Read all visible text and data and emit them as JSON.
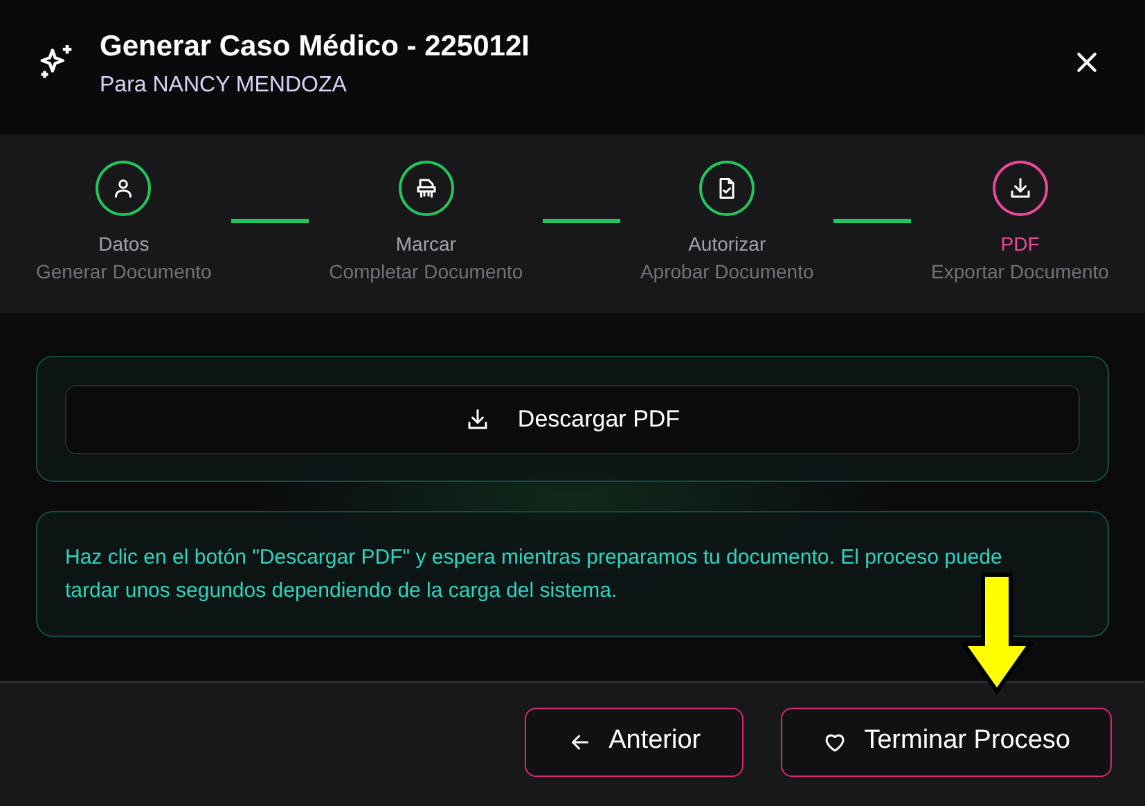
{
  "header": {
    "title": "Generar Caso Médico - 225012I",
    "subtitle": "Para NANCY MENDOZA"
  },
  "steps": [
    {
      "label": "Datos",
      "caption": "Generar Documento",
      "selected": false
    },
    {
      "label": "Marcar",
      "caption": "Completar Documento",
      "selected": false
    },
    {
      "label": "Autorizar",
      "caption": "Aprobar Documento",
      "selected": false
    },
    {
      "label": "PDF",
      "caption": "Exportar Documento",
      "selected": true
    }
  ],
  "download_button": {
    "label": "Descargar PDF"
  },
  "info_message": "Haz clic en el botón \"Descargar PDF\" y espera mientras preparamos tu documento. El proceso puede tardar unos segundos dependiendo de la carga del sistema.",
  "footer_buttons": [
    {
      "kind": "back",
      "label": "Anterior"
    },
    {
      "kind": "finish",
      "label": "Terminar Proceso"
    }
  ]
}
